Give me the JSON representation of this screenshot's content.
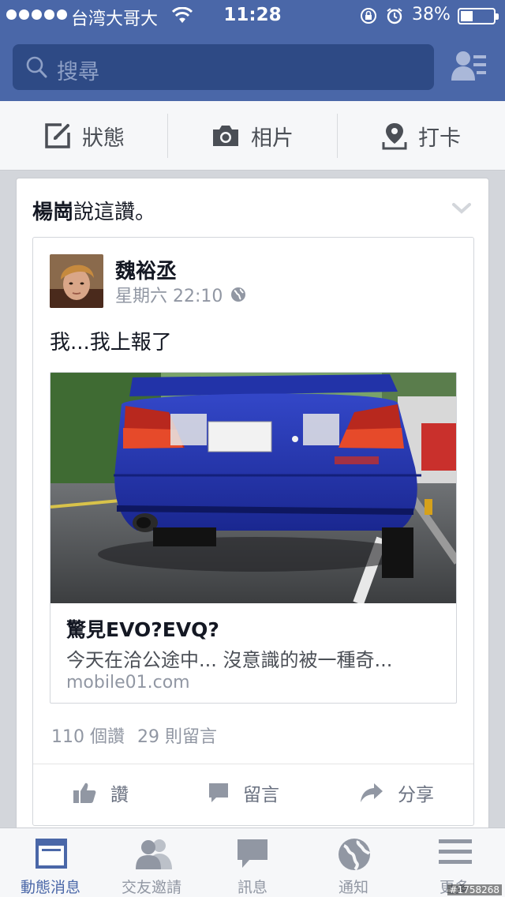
{
  "statusbar": {
    "carrier": "台湾大哥大",
    "time": "11:28",
    "battery": "38%",
    "battery_level": 0.38
  },
  "search": {
    "placeholder": "搜尋"
  },
  "composer": {
    "status_label": "狀態",
    "photo_label": "相片",
    "checkin_label": "打卡"
  },
  "story": {
    "liker": "楊崗",
    "header_suffix": "說這讚。",
    "author": "魏裕丞",
    "time": "星期六 22:10",
    "text": "我...我上報了",
    "link": {
      "title": "驚見EVO?EVQ?",
      "description": "今天在洽公途中... 沒意識的被一種奇...",
      "domain": "mobile01.com"
    },
    "likes_count": "110 個讚",
    "comments_count": "29 則留言",
    "actions": {
      "like": "讚",
      "comment": "留言",
      "share": "分享"
    }
  },
  "tabbar": {
    "items": [
      {
        "label": "動態消息",
        "icon": "news-feed-icon",
        "active": true
      },
      {
        "label": "交友邀請",
        "icon": "friend-requests-icon",
        "active": false
      },
      {
        "label": "訊息",
        "icon": "messages-icon",
        "active": false
      },
      {
        "label": "通知",
        "icon": "globe-icon",
        "active": false
      },
      {
        "label": "更多",
        "icon": "menu-icon",
        "active": false
      }
    ]
  },
  "watermark": "#1758268",
  "colors": {
    "header": "#4a67a8",
    "search_bg": "#2e4a85",
    "car_body": "#2b3fbf"
  }
}
